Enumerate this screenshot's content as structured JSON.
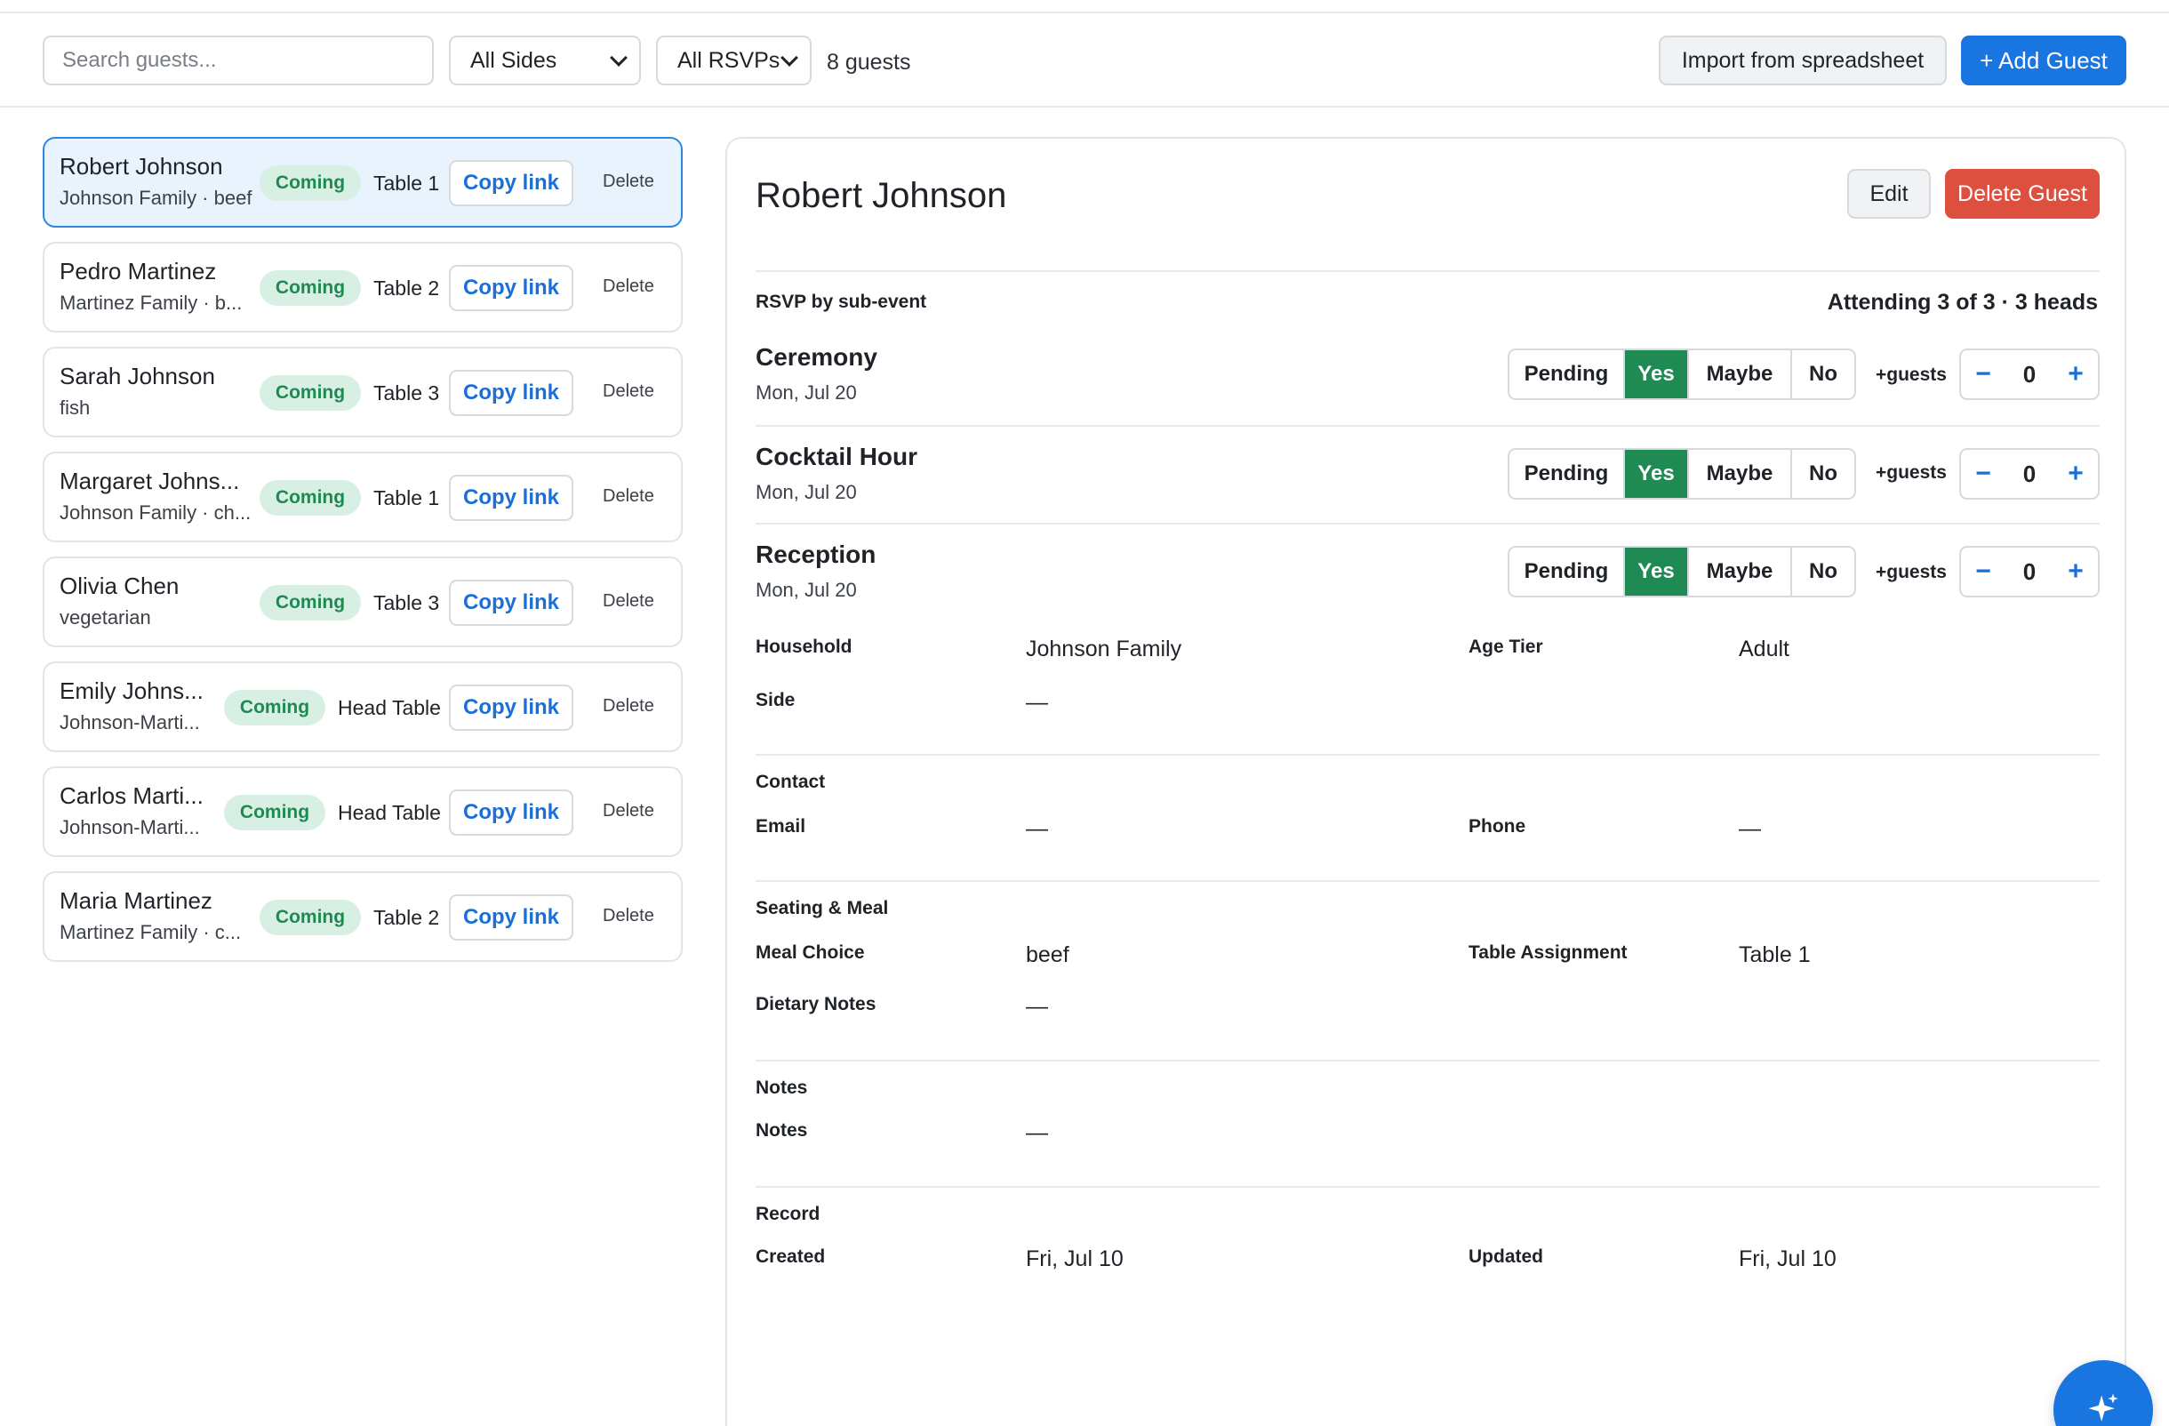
{
  "toolbar": {
    "search_placeholder": "Search guests...",
    "side_filter": "All Sides",
    "rsvp_filter": "All RSVPs",
    "guest_count": "8 guests",
    "import_label": "Import from spreadsheet",
    "add_label": "+ Add Guest"
  },
  "guests": [
    {
      "name": "Robert Johnson",
      "sub": "Johnson Family · beef",
      "status": "Coming",
      "table": "Table 1",
      "copy": "Copy link",
      "delete": "Delete"
    },
    {
      "name": "Pedro Martinez",
      "sub": "Martinez Family · b...",
      "status": "Coming",
      "table": "Table 2",
      "copy": "Copy link",
      "delete": "Delete"
    },
    {
      "name": "Sarah Johnson",
      "sub": "fish",
      "status": "Coming",
      "table": "Table 3",
      "copy": "Copy link",
      "delete": "Delete"
    },
    {
      "name": "Margaret Johns...",
      "sub": "Johnson Family · ch...",
      "status": "Coming",
      "table": "Table 1",
      "copy": "Copy link",
      "delete": "Delete"
    },
    {
      "name": "Olivia Chen",
      "sub": "vegetarian",
      "status": "Coming",
      "table": "Table 3",
      "copy": "Copy link",
      "delete": "Delete"
    },
    {
      "name": "Emily Johns...",
      "sub": "Johnson-Marti...",
      "status": "Coming",
      "table": "Head Table",
      "copy": "Copy link",
      "delete": "Delete"
    },
    {
      "name": "Carlos Marti...",
      "sub": "Johnson-Marti...",
      "status": "Coming",
      "table": "Head Table",
      "copy": "Copy link",
      "delete": "Delete"
    },
    {
      "name": "Maria Martinez",
      "sub": "Martinez Family · c...",
      "status": "Coming",
      "table": "Table 2",
      "copy": "Copy link",
      "delete": "Delete"
    }
  ],
  "detail": {
    "title": "Robert Johnson",
    "edit_label": "Edit",
    "delete_label": "Delete Guest",
    "rsvp_heading": "RSVP by sub-event",
    "attending": "Attending 3 of 3 · 3 heads",
    "rsvp_options": [
      "Pending",
      "Yes",
      "Maybe",
      "No"
    ],
    "plus_guests_label": "+guests",
    "events": [
      {
        "name": "Ceremony",
        "date": "Mon, Jul 20",
        "selected": "Yes",
        "plus": "0"
      },
      {
        "name": "Cocktail Hour",
        "date": "Mon, Jul 20",
        "selected": "Yes",
        "plus": "0"
      },
      {
        "name": "Reception",
        "date": "Mon, Jul 20",
        "selected": "Yes",
        "plus": "0"
      }
    ],
    "household_label": "Household",
    "household_value": "Johnson Family",
    "age_tier_label": "Age Tier",
    "age_tier_value": "Adult",
    "side_label": "Side",
    "side_value": "—",
    "contact_heading": "Contact",
    "email_label": "Email",
    "email_value": "—",
    "phone_label": "Phone",
    "phone_value": "—",
    "seating_heading": "Seating & Meal",
    "meal_label": "Meal Choice",
    "meal_value": "beef",
    "table_label": "Table Assignment",
    "table_value": "Table 1",
    "dietary_label": "Dietary Notes",
    "dietary_value": "—",
    "notes_heading": "Notes",
    "notes_label": "Notes",
    "notes_value": "—",
    "record_heading": "Record",
    "created_label": "Created",
    "created_value": "Fri, Jul 10",
    "updated_label": "Updated",
    "updated_value": "Fri, Jul 10"
  },
  "colors": {
    "accent": "#1976e0",
    "coming_badge_bg": "#d8efe3",
    "coming_badge_text": "#1e8a51",
    "yes_active": "#1f8a53",
    "danger": "#dd4f3f"
  }
}
